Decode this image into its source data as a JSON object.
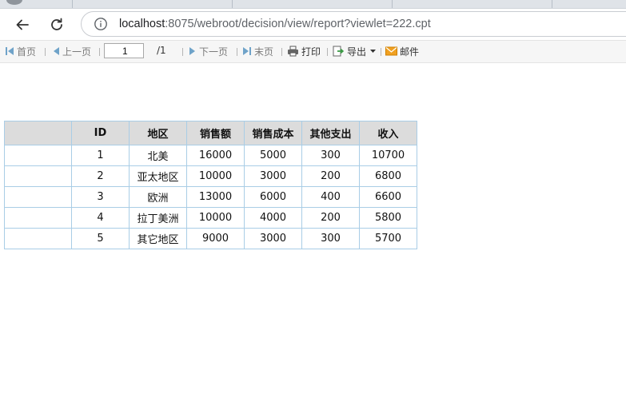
{
  "browser": {
    "url_host": "localhost",
    "url_rest": ":8075/webroot/decision/view/report?viewlet=222.cpt"
  },
  "toolbar": {
    "first_page": "首页",
    "prev_page": "上一页",
    "current_page": "1",
    "total_pages": "/1",
    "next_page": "下一页",
    "last_page": "末页",
    "print": "打印",
    "export": "导出",
    "email": "邮件"
  },
  "report": {
    "columns": [
      "",
      "ID",
      "地区",
      "销售额",
      "销售成本",
      "其他支出",
      "收入"
    ],
    "rows": [
      [
        "",
        "1",
        "北美",
        "16000",
        "5000",
        "300",
        "10700"
      ],
      [
        "",
        "2",
        "亚太地区",
        "10000",
        "3000",
        "200",
        "6800"
      ],
      [
        "",
        "3",
        "欧洲",
        "13000",
        "6000",
        "400",
        "6600"
      ],
      [
        "",
        "4",
        "拉丁美洲",
        "10000",
        "4000",
        "200",
        "5800"
      ],
      [
        "",
        "5",
        "其它地区",
        "9000",
        "3000",
        "300",
        "5700"
      ]
    ]
  },
  "colors": {
    "table_border": "#a9cde6",
    "header_bg": "#dcdcdc",
    "toolbar_icon": "#6fa3c9",
    "export_icon": "#3a9a44",
    "email_icon": "#f0a020"
  },
  "icons": {
    "back": "arrow-left-icon",
    "reload": "reload-icon",
    "site_info": "info-icon",
    "first": "first-page-icon",
    "prev": "prev-page-icon",
    "next": "next-page-icon",
    "last": "last-page-icon",
    "print": "printer-icon",
    "export": "export-icon",
    "export_caret": "caret-down-icon",
    "email": "envelope-icon"
  }
}
